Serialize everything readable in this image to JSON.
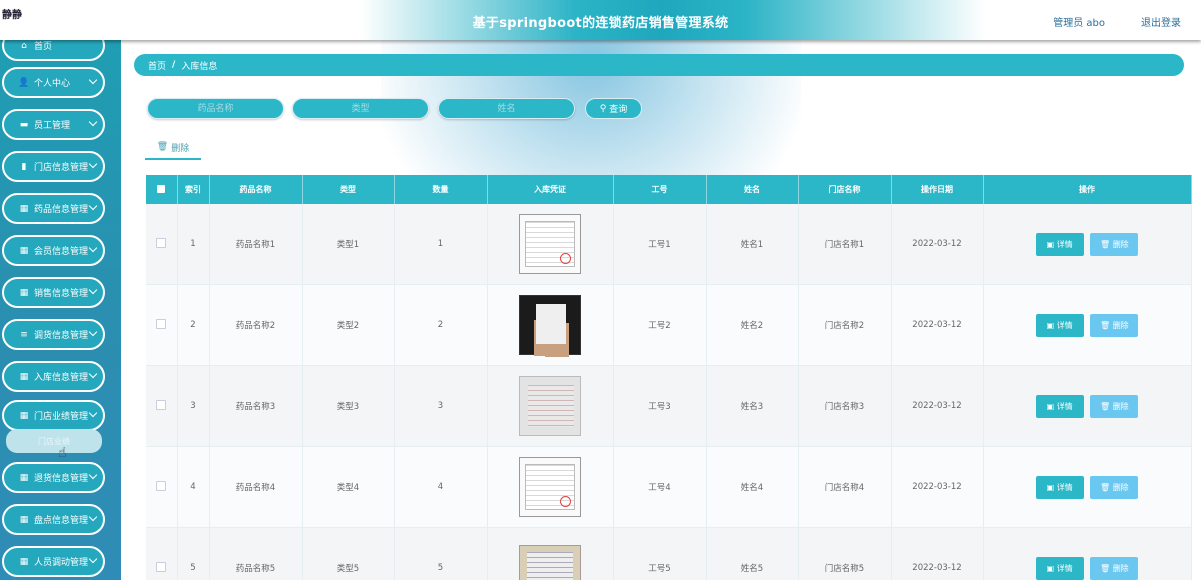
{
  "header": {
    "brand": "静静",
    "title": "基于springboot的连锁药店销售管理系统",
    "user": "管理员 abo",
    "logout": "退出登录"
  },
  "sidebar": {
    "items": [
      {
        "label": "首页",
        "icon": "⌂",
        "chevron": false
      },
      {
        "label": "个人中心",
        "icon": "👤",
        "chevron": true
      },
      {
        "label": "员工管理",
        "icon": "▬",
        "chevron": true
      },
      {
        "label": "门店信息管理",
        "icon": "▮",
        "chevron": true
      },
      {
        "label": "药品信息管理",
        "icon": "▦",
        "chevron": true
      },
      {
        "label": "会员信息管理",
        "icon": "▦",
        "chevron": true
      },
      {
        "label": "销售信息管理",
        "icon": "▦",
        "chevron": true
      },
      {
        "label": "调货信息管理",
        "icon": "≡",
        "chevron": true
      },
      {
        "label": "入库信息管理",
        "icon": "▦",
        "chevron": true
      },
      {
        "label": "门店业绩管理",
        "icon": "▦",
        "chevron": true
      },
      {
        "label": "退货信息管理",
        "icon": "▦",
        "chevron": true
      },
      {
        "label": "盘点信息管理",
        "icon": "▦",
        "chevron": true
      },
      {
        "label": "人员调动管理",
        "icon": "▦",
        "chevron": true
      }
    ],
    "submenu_label": "门店业绩"
  },
  "breadcrumb": {
    "home": "首页",
    "separator": "/",
    "current": "入库信息"
  },
  "search": {
    "drug_name_placeholder": "药品名称",
    "type_placeholder": "类型",
    "name_placeholder": "姓名",
    "query_label": "查询"
  },
  "toolbar": {
    "delete_label": "删除"
  },
  "table": {
    "headers": [
      "索引",
      "药品名称",
      "类型",
      "数量",
      "入库凭证",
      "工号",
      "姓名",
      "门店名称",
      "操作日期",
      "操作"
    ],
    "rows": [
      {
        "index": "1",
        "drug": "药品名称1",
        "type": "类型1",
        "qty": "1",
        "emp": "工号1",
        "name": "姓名1",
        "store": "门店名称1",
        "date": "2022-03-12"
      },
      {
        "index": "2",
        "drug": "药品名称2",
        "type": "类型2",
        "qty": "2",
        "emp": "工号2",
        "name": "姓名2",
        "store": "门店名称2",
        "date": "2022-03-12"
      },
      {
        "index": "3",
        "drug": "药品名称3",
        "type": "类型3",
        "qty": "3",
        "emp": "工号3",
        "name": "姓名3",
        "store": "门店名称3",
        "date": "2022-03-12"
      },
      {
        "index": "4",
        "drug": "药品名称4",
        "type": "类型4",
        "qty": "4",
        "emp": "工号4",
        "name": "姓名4",
        "store": "门店名称4",
        "date": "2022-03-12"
      },
      {
        "index": "5",
        "drug": "药品名称5",
        "type": "类型5",
        "qty": "5",
        "emp": "工号5",
        "name": "姓名5",
        "store": "门店名称5",
        "date": "2022-03-12"
      }
    ],
    "detail_label": "详情",
    "delete_label": "删除"
  },
  "colors": {
    "accent": "#2bb7c8",
    "sidebar": "#2a8fb0",
    "delete_button": "#6ac7ef"
  }
}
